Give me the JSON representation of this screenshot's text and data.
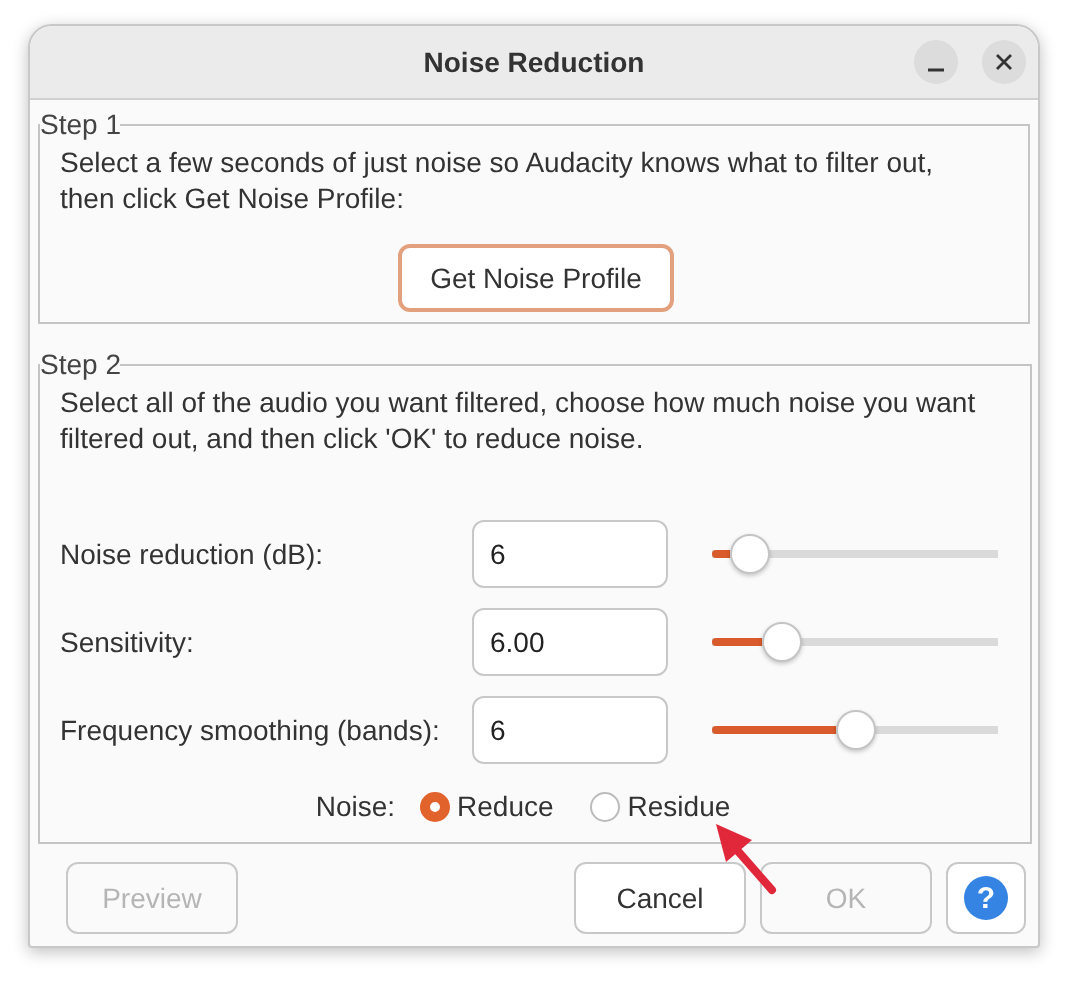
{
  "window": {
    "title": "Noise Reduction"
  },
  "step1": {
    "legend": "Step 1",
    "text": "Select a few seconds of just noise so Audacity knows what to filter out, then click Get Noise Profile:",
    "button": "Get Noise Profile"
  },
  "step2": {
    "legend": "Step 2",
    "text": "Select all of the audio you want filtered, choose how much noise you want filtered out, and then click 'OK' to reduce noise.",
    "params": [
      {
        "label": "Noise reduction (dB):",
        "value": "6",
        "level": 0.13
      },
      {
        "label": "Sensitivity:",
        "value": "6.00",
        "level": 0.245
      },
      {
        "label": "Frequency smoothing (bands):",
        "value": "6",
        "level": 0.5
      }
    ],
    "noise": {
      "label": "Noise:",
      "options": [
        {
          "label": "Reduce",
          "selected": true
        },
        {
          "label": "Residue",
          "selected": false
        }
      ]
    }
  },
  "buttons": [
    {
      "kind": "preview",
      "label": "Preview",
      "disabled": true
    },
    {
      "kind": "cancel",
      "label": "Cancel",
      "disabled": false
    },
    {
      "kind": "ok",
      "label": "OK",
      "disabled": true
    },
    {
      "kind": "help",
      "label": "?",
      "disabled": false
    }
  ]
}
